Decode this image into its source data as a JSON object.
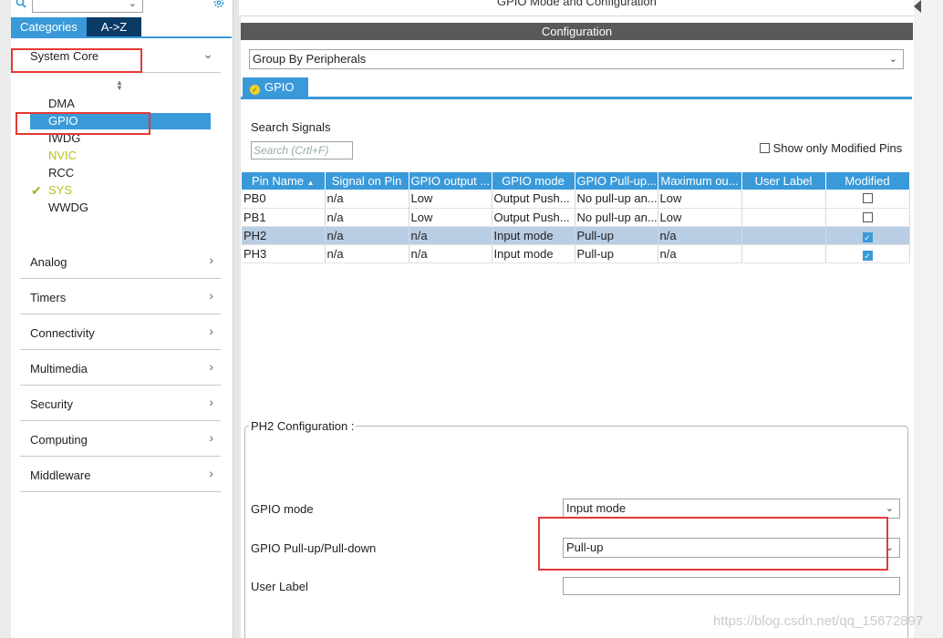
{
  "left": {
    "tabs": {
      "categories": "Categories",
      "az": "A->Z"
    },
    "system_core": "System Core",
    "items": [
      "DMA",
      "GPIO",
      "IWDG",
      "NVIC",
      "RCC",
      "SYS",
      "WWDG"
    ],
    "groups": [
      "Analog",
      "Timers",
      "Connectivity",
      "Multimedia",
      "Security",
      "Computing",
      "Middleware"
    ]
  },
  "header": {
    "title": "GPIO Mode and Configuration",
    "config_bar": "Configuration"
  },
  "group_by": {
    "value": "Group By Peripherals"
  },
  "gpio_tab": "GPIO",
  "signals": {
    "search_label": "Search Signals",
    "search_placeholder": "Search (Crtl+F)",
    "modified_only_label": "Show only Modified Pins",
    "columns": [
      "Pin Name",
      "Signal on Pin",
      "GPIO output ...",
      "GPIO mode",
      "GPIO Pull-up...",
      "Maximum ou...",
      "User Label",
      "Modified"
    ],
    "rows": [
      {
        "pin": "PB0",
        "signal": "n/a",
        "output": "Low",
        "mode": "Output Push...",
        "pull": "No pull-up an...",
        "max": "Low",
        "label": "",
        "modified": false
      },
      {
        "pin": "PB1",
        "signal": "n/a",
        "output": "Low",
        "mode": "Output Push...",
        "pull": "No pull-up an...",
        "max": "Low",
        "label": "",
        "modified": false
      },
      {
        "pin": "PH2",
        "signal": "n/a",
        "output": "n/a",
        "mode": "Input mode",
        "pull": "Pull-up",
        "max": "n/a",
        "label": "",
        "modified": true
      },
      {
        "pin": "PH3",
        "signal": "n/a",
        "output": "n/a",
        "mode": "Input mode",
        "pull": "Pull-up",
        "max": "n/a",
        "label": "",
        "modified": true
      }
    ]
  },
  "ph2_config": {
    "legend": "PH2 Configuration :",
    "gpio_mode_label": "GPIO mode",
    "gpio_mode_value": "Input mode",
    "pull_label": "GPIO Pull-up/Pull-down",
    "pull_value": "Pull-up",
    "user_label_label": "User Label",
    "user_label_value": ""
  },
  "watermark": "https://blog.csdn.net/qq_15672897",
  "colors": {
    "accent": "#3a9ad9",
    "highlight": "#e53935",
    "nav_dark": "#0a3a66"
  }
}
